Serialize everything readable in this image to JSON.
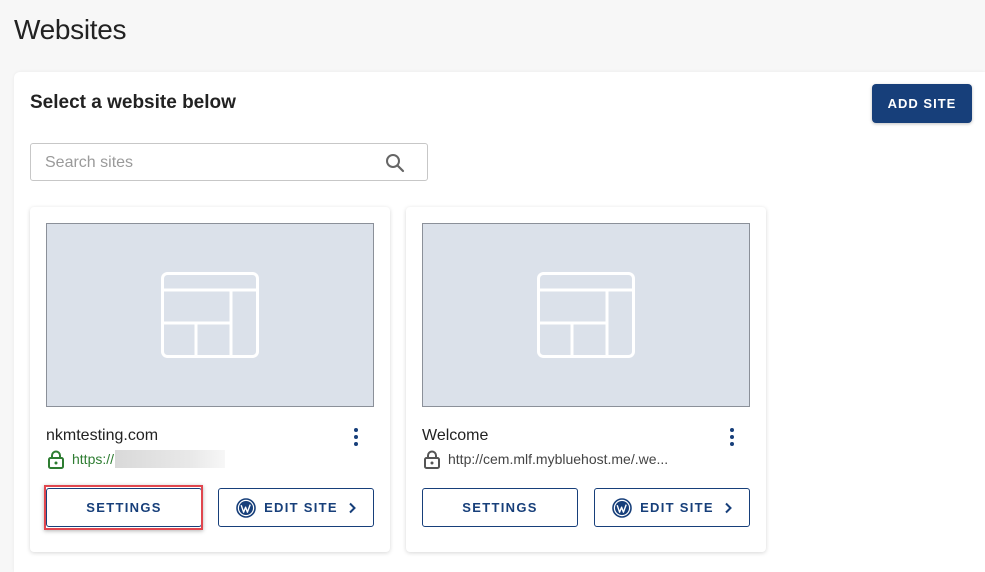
{
  "page": {
    "title": "Websites"
  },
  "panel": {
    "heading": "Select a website below",
    "add_site_label": "ADD SITE"
  },
  "search": {
    "placeholder": "Search sites",
    "value": ""
  },
  "sites": [
    {
      "name": "nkmtesting.com",
      "url": "https://",
      "secure": true,
      "settings_label": "SETTINGS",
      "edit_label": "EDIT SITE",
      "settings_highlighted": true
    },
    {
      "name": "Welcome",
      "url": "http://cem.mlf.mybluehost.me/.we...",
      "secure": false,
      "settings_label": "SETTINGS",
      "edit_label": "EDIT SITE",
      "settings_highlighted": false
    }
  ],
  "icons": {
    "search": "search-icon",
    "layout_placeholder": "layout-placeholder-icon",
    "kebab": "kebab-menu-icon",
    "lock": "lock-icon",
    "wordpress": "wordpress-icon",
    "chevron": "chevron-right-icon"
  },
  "colors": {
    "brand": "#173f7a",
    "secure_url": "#2e7d32",
    "highlight": "#e0464e",
    "thumbnail_bg": "#dbe1ea"
  }
}
